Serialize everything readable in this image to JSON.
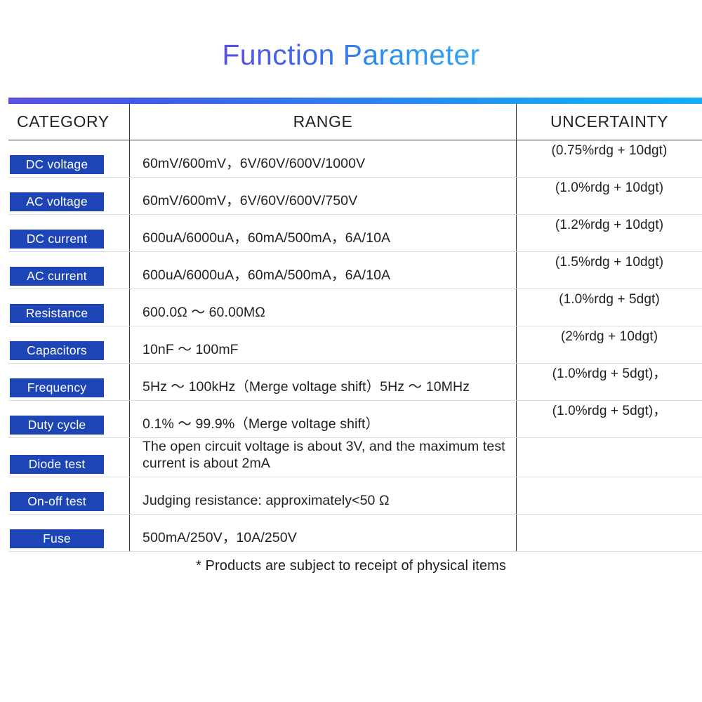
{
  "page": {
    "title": "Function Parameter",
    "footnote": "* Products are subject to receipt of physical items",
    "accent_gradient_start": "#5b4fe0",
    "accent_gradient_end": "#12aef7",
    "badge_color": "#1d45b5",
    "text_color": "#231f20"
  },
  "table": {
    "headers": {
      "category": "CATEGORY",
      "range": "RANGE",
      "uncertainty": "UNCERTAINTY"
    },
    "rows": [
      {
        "category": "DC voltage",
        "range": "60mV/600mV，6V/60V/600V/1000V",
        "uncertainty": "(0.75%rdg + 10dgt)"
      },
      {
        "category": "AC voltage",
        "range": "60mV/600mV，6V/60V/600V/750V",
        "uncertainty": "(1.0%rdg + 10dgt)"
      },
      {
        "category": "DC current",
        "range": "600uA/6000uA，60mA/500mA，6A/10A",
        "uncertainty": "(1.2%rdg + 10dgt)"
      },
      {
        "category": "AC current",
        "range": "600uA/6000uA，60mA/500mA，6A/10A",
        "uncertainty": "(1.5%rdg + 10dgt)"
      },
      {
        "category": "Resistance",
        "range": "600.0Ω ～ 60.00MΩ",
        "uncertainty": "(1.0%rdg + 5dgt)"
      },
      {
        "category": "Capacitors",
        "range": "10nF ～ 100mF",
        "uncertainty": "(2%rdg + 10dgt)"
      },
      {
        "category": "Frequency",
        "range": "5Hz ～ 100kHz（Merge voltage shift）5Hz ～ 10MHz",
        "uncertainty": "(1.0%rdg + 5dgt)，"
      },
      {
        "category": "Duty cycle",
        "range": "0.1% ～ 99.9%（Merge voltage shift）",
        "uncertainty": "(1.0%rdg + 5dgt)，"
      },
      {
        "category": "Diode test",
        "range": "The open circuit voltage is about 3V, and the maximum test current is about 2mA",
        "uncertainty": ""
      },
      {
        "category": "On-off test",
        "range": "Judging resistance: approximately<50 Ω",
        "uncertainty": ""
      },
      {
        "category": "Fuse",
        "range": "500mA/250V，10A/250V",
        "uncertainty": ""
      }
    ]
  }
}
